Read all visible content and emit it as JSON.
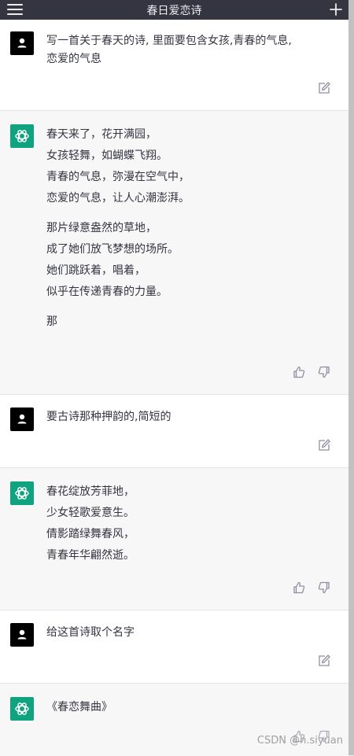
{
  "header": {
    "title": "春日爱恋诗"
  },
  "messages": [
    {
      "role": "user",
      "lines": [
        "写一首关于春天的诗, 里面要包含女孩,青春的气息,",
        "恋爱的气息"
      ]
    },
    {
      "role": "assistant",
      "paragraphs": [
        [
          "春天来了，花开满园，",
          "女孩轻舞，如蝴蝶飞翔。",
          "青春的气息，弥漫在空气中，",
          "恋爱的气息，让人心潮澎湃。"
        ],
        [
          "那片绿意盎然的草地，",
          "成了她们放飞梦想的场所。",
          "她们跳跃着，唱着，",
          "似乎在传递青春的力量。"
        ],
        [
          "那"
        ]
      ]
    },
    {
      "role": "user",
      "lines": [
        "要古诗那种押韵的,简短的"
      ]
    },
    {
      "role": "assistant",
      "paragraphs": [
        [
          "春花绽放芳菲地，",
          "少女轻歌爱意生。",
          "倩影踏绿舞春风，",
          "青春年华翩然逝。"
        ]
      ]
    },
    {
      "role": "user",
      "lines": [
        "给这首诗取个名字"
      ]
    },
    {
      "role": "assistant",
      "paragraphs": [
        [
          "《春恋舞曲》"
        ]
      ]
    }
  ],
  "watermark": "CSDN @h.siyuan",
  "colors": {
    "header_bg": "#343541",
    "user_bg": "#ffffff",
    "assistant_bg": "#f7f7f8",
    "assistant_avatar": "#10a37f",
    "user_avatar": "#000000"
  },
  "icons": {
    "menu": "hamburger-menu-icon",
    "new_chat": "plus-icon",
    "edit": "edit-icon",
    "like": "thumbs-up-icon",
    "dislike": "thumbs-down-icon",
    "user_avatar": "user-icon",
    "bot_avatar": "openai-logo-icon"
  }
}
